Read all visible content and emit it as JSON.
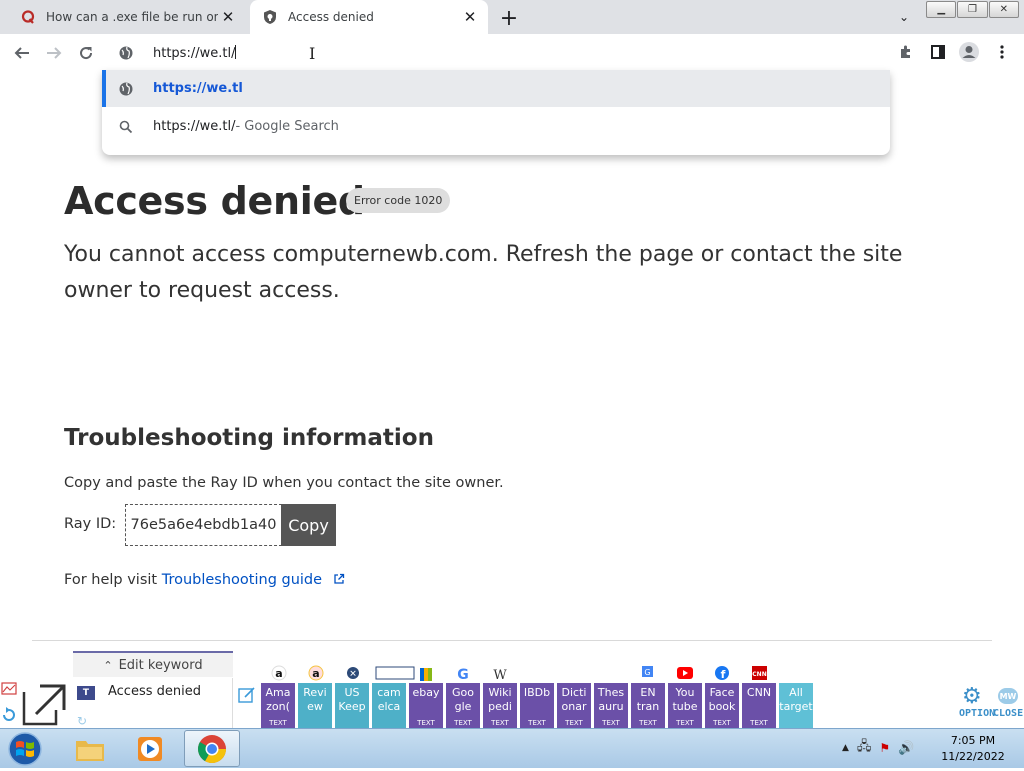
{
  "browser": {
    "tabs": [
      {
        "title": "How can a .exe file be run online",
        "favicon": "quora-icon"
      },
      {
        "title": "Access denied",
        "favicon": "cloudflare-shield-icon"
      }
    ],
    "new_tab_label": "+",
    "address_bar": {
      "value": "https://we.tl/"
    },
    "suggestions": [
      {
        "url": "https://we.tl",
        "icon": "globe-icon"
      },
      {
        "text": "https://we.tl/",
        "desc": " - Google Search",
        "icon": "search-icon"
      }
    ]
  },
  "page": {
    "title": "Access denied",
    "error_badge": "Error code 1020",
    "message": "You cannot access computernewb.com. Refresh the page or contact the site owner to request access.",
    "troubleshooting_heading": "Troubleshooting information",
    "copy_instructions": "Copy and paste the Ray ID when you contact the site owner.",
    "ray_label": "Ray ID:",
    "ray_id": "76e5a6e4ebdb1a40",
    "copy_button": "Copy",
    "help_prefix": "For help visit ",
    "help_link": "Troubleshooting guide"
  },
  "keyword_toolbar": {
    "tab_label": "Edit keyword",
    "current_keyword": "Access denied",
    "buttons": [
      {
        "label": "Ama zon(",
        "sub": "TEXT",
        "color": "purple"
      },
      {
        "label": "Revi ew",
        "sub": "",
        "color": "teal"
      },
      {
        "label": "US Keep",
        "sub": "",
        "color": "teal"
      },
      {
        "label": "cam elca",
        "sub": "",
        "color": "teal"
      },
      {
        "label": "ebay",
        "sub": "TEXT",
        "color": "purple"
      },
      {
        "label": "Goo gle",
        "sub": "TEXT",
        "color": "purple"
      },
      {
        "label": "Wiki pedi",
        "sub": "TEXT",
        "color": "purple"
      },
      {
        "label": "IBDb",
        "sub": "TEXT",
        "color": "purple"
      },
      {
        "label": "Dicti onar",
        "sub": "TEXT",
        "color": "purple"
      },
      {
        "label": "Thes auru",
        "sub": "TEXT",
        "color": "purple"
      },
      {
        "label": "EN tran",
        "sub": "TEXT",
        "color": "purple"
      },
      {
        "label": "You tube",
        "sub": "TEXT",
        "color": "purple"
      },
      {
        "label": "Face book",
        "sub": "TEXT",
        "color": "purple"
      },
      {
        "label": "CNN",
        "sub": "TEXT",
        "color": "purple"
      },
      {
        "label": "All target",
        "sub": "",
        "color": "teal2"
      }
    ],
    "option_label": "OPTION",
    "close_label": "CLOSE"
  },
  "taskbar": {
    "time": "7:05 PM",
    "date": "11/22/2022"
  }
}
